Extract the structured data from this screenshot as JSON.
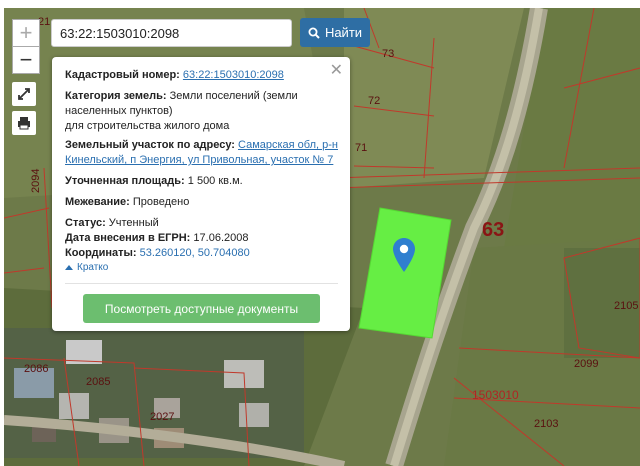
{
  "search": {
    "value": "63:22:1503010:2098",
    "button_label": "Найти"
  },
  "zoom": {
    "in_label": "+",
    "out_label": "−"
  },
  "popup": {
    "cadastral_label": "Кадастровый номер:",
    "cadastral_value": "63:22:1503010:2098",
    "category_label": "Категория земель:",
    "category_value": " Земли поселений (земли",
    "category_line2": "населенных пунктов)",
    "category_line3": "для строительства жилого дома",
    "address_label": "Земельный участок по адресу:",
    "address_value_1": "Самарская обл, р-н",
    "address_value_2": "Кинельский, п Энергия, ул Привольная, участок № 7",
    "area_label": "Уточненная площадь:",
    "area_value": " 1 500 кв.м.",
    "survey_label": "Межевание:",
    "survey_value": " Проведено",
    "status_label": "Статус:",
    "status_value": " Учтенный",
    "egrn_label": "Дата внесения в ЕГРН:",
    "egrn_value": " 17.06.2008",
    "coords_label": "Координаты:",
    "coords_value": " 53.260120, 50.704080",
    "brief_label": "Кратко",
    "docs_button": "Посмотреть доступные документы"
  },
  "map_labels": {
    "p73": "73",
    "p72": "72",
    "p71": "71",
    "p63": "63",
    "p2094": "2094",
    "p2105": "2105",
    "p2099": "2099",
    "p2103": "2103",
    "p2086": "2086",
    "p2085": "2085",
    "p2027": "2027",
    "quarter": "1503010",
    "p21": "21"
  },
  "colors": {
    "accent": "#2e6ea4",
    "parcel": "#66ee44",
    "button_green": "#6cbe6f",
    "boundary": "#c0392b"
  }
}
